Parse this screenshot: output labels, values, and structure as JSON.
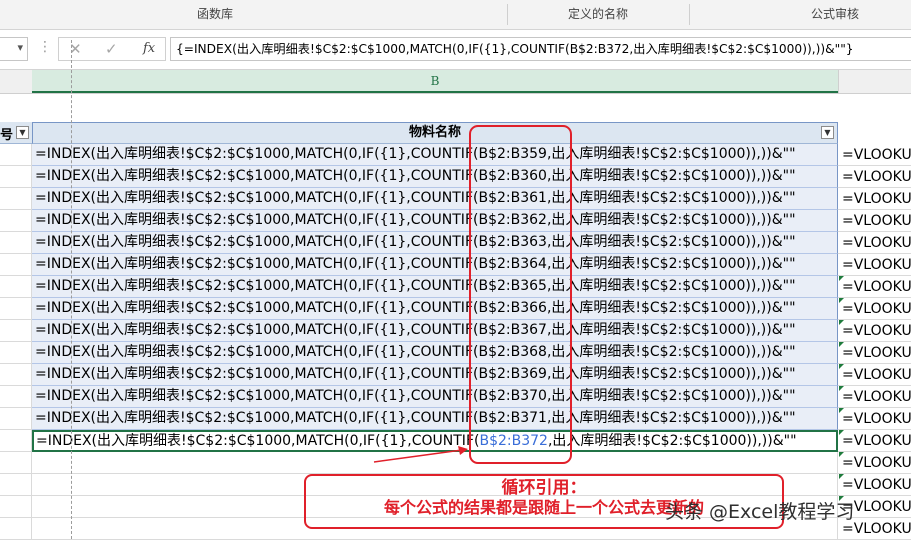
{
  "ribbon": {
    "groups": [
      "函数库",
      "定义的名称",
      "公式审核"
    ]
  },
  "formula_bar": {
    "cancel_icon": "✕",
    "enter_icon": "✓",
    "fx_label": "fx",
    "formula": "{=INDEX(出入库明细表!$C$2:$C$1000,MATCH(0,IF({1},COUNTIF(B$2:B372,出入库明细表!$C$2:$C$1000)),))&\"\"}"
  },
  "columns": {
    "b_header": "B"
  },
  "table": {
    "col_a_header": "号",
    "col_b_header": "物料名称",
    "rows": [
      {
        "pre": "=INDEX(出入库明细表!$C$2:$C$1000,MATCH(0,IF({1},COUNTIF(",
        "ref": "B$2:B359",
        "post": ",出入库明细表!$C$2:$C$1000)),))&\"\""
      },
      {
        "pre": "=INDEX(出入库明细表!$C$2:$C$1000,MATCH(0,IF({1},COUNTIF(",
        "ref": "B$2:B360",
        "post": ",出入库明细表!$C$2:$C$1000)),))&\"\""
      },
      {
        "pre": "=INDEX(出入库明细表!$C$2:$C$1000,MATCH(0,IF({1},COUNTIF(",
        "ref": "B$2:B361",
        "post": ",出入库明细表!$C$2:$C$1000)),))&\"\""
      },
      {
        "pre": "=INDEX(出入库明细表!$C$2:$C$1000,MATCH(0,IF({1},COUNTIF(",
        "ref": "B$2:B362",
        "post": ",出入库明细表!$C$2:$C$1000)),))&\"\""
      },
      {
        "pre": "=INDEX(出入库明细表!$C$2:$C$1000,MATCH(0,IF({1},COUNTIF(",
        "ref": "B$2:B363",
        "post": ",出入库明细表!$C$2:$C$1000)),))&\"\""
      },
      {
        "pre": "=INDEX(出入库明细表!$C$2:$C$1000,MATCH(0,IF({1},COUNTIF(",
        "ref": "B$2:B364",
        "post": ",出入库明细表!$C$2:$C$1000)),))&\"\""
      },
      {
        "pre": "=INDEX(出入库明细表!$C$2:$C$1000,MATCH(0,IF({1},COUNTIF(",
        "ref": "B$2:B365",
        "post": ",出入库明细表!$C$2:$C$1000)),))&\"\""
      },
      {
        "pre": "=INDEX(出入库明细表!$C$2:$C$1000,MATCH(0,IF({1},COUNTIF(",
        "ref": "B$2:B366",
        "post": ",出入库明细表!$C$2:$C$1000)),))&\"\""
      },
      {
        "pre": "=INDEX(出入库明细表!$C$2:$C$1000,MATCH(0,IF({1},COUNTIF(",
        "ref": "B$2:B367",
        "post": ",出入库明细表!$C$2:$C$1000)),))&\"\""
      },
      {
        "pre": "=INDEX(出入库明细表!$C$2:$C$1000,MATCH(0,IF({1},COUNTIF(",
        "ref": "B$2:B368",
        "post": ",出入库明细表!$C$2:$C$1000)),))&\"\""
      },
      {
        "pre": "=INDEX(出入库明细表!$C$2:$C$1000,MATCH(0,IF({1},COUNTIF(",
        "ref": "B$2:B369",
        "post": ",出入库明细表!$C$2:$C$1000)),))&\"\""
      },
      {
        "pre": "=INDEX(出入库明细表!$C$2:$C$1000,MATCH(0,IF({1},COUNTIF(",
        "ref": "B$2:B370",
        "post": ",出入库明细表!$C$2:$C$1000)),))&\"\""
      },
      {
        "pre": "=INDEX(出入库明细表!$C$2:$C$1000,MATCH(0,IF({1},COUNTIF(",
        "ref": "B$2:B371",
        "post": ",出入库明细表!$C$2:$C$1000)),))&\"\""
      },
      {
        "pre": "=INDEX(出入库明细表!$C$2:$C$1000,MATCH(0,IF({1},COUNTIF(",
        "ref": "B$2:B372",
        "post": ",出入库明细表!$C$2:$C$1000)),))&\"\""
      }
    ],
    "col_c_text": "=VLOOKU",
    "empty_rows_col_c": [
      "=VLOOKU",
      "=VLOOKU",
      "=VLOOKU",
      "=VLOOKU"
    ]
  },
  "annotation": {
    "line1": "循环引用：",
    "line2": "每个公式的结果都是跟随上一个公式去更新的",
    "accent_color": "#e0202a"
  },
  "watermark": "头条 @Excel教程学习"
}
